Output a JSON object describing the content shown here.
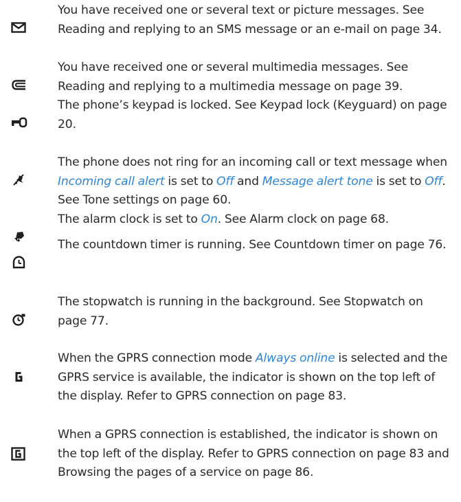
{
  "entries": [
    {
      "icon": "envelope-icon",
      "segments": [
        "You have received one or several text or picture messages. See Reading and replying to an SMS message or an e-mail on page 34."
      ]
    },
    {
      "icon": "multimedia-message-icon",
      "segments": [
        "You have received one or several multimedia messages. See Reading and replying to a multimedia message on page 39."
      ]
    },
    {
      "icon": "keypad-lock-icon",
      "segments": [
        "The phone’s keypad is locked. See Keypad lock (Keyguard) on page 20."
      ]
    },
    {
      "icon": "silent-bell-icon",
      "segments": [
        "The phone does not ring for an incoming call or text message when ",
        "Incoming call alert",
        " is set to ",
        "Off",
        " and ",
        "Message alert tone",
        " is set to ",
        "Off",
        ". See Tone settings on page 60."
      ]
    },
    {
      "icon": "alarm-clock-icon",
      "segments": [
        "The alarm clock is set to ",
        "On",
        ". See Alarm clock on page 68."
      ]
    },
    {
      "icon": "countdown-timer-icon",
      "segments": [
        "The countdown timer is running. See Countdown timer on page 76."
      ]
    },
    {
      "icon": "stopwatch-icon",
      "segments": [
        "The stopwatch is running in the background. See Stopwatch on page 77."
      ]
    },
    {
      "icon": "gprs-always-online-icon",
      "segments": [
        "When the GPRS connection mode ",
        "Always online",
        " is selected and the GPRS service is available, the indicator is shown on the top left of the display. Refer to GPRS connection on page 83."
      ]
    },
    {
      "icon": "gprs-connected-icon",
      "segments": [
        "When a GPRS connection is established, the indicator is shown on the top left of the display. Refer to GPRS connection on page 83 and Browsing the pages of a service on page 86."
      ]
    }
  ],
  "colors": {
    "text": "#2a2a2a",
    "highlight": "#2e86d6"
  }
}
